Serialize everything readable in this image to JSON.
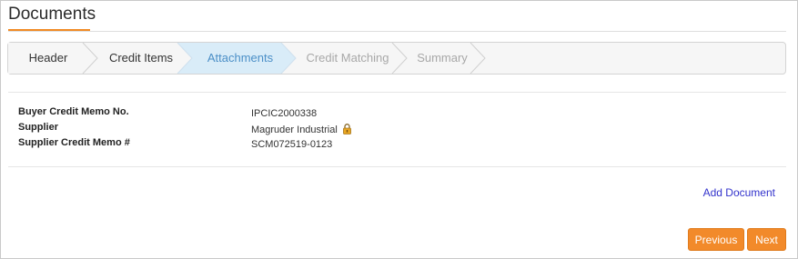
{
  "page": {
    "title": "Documents"
  },
  "wizard": {
    "steps": [
      {
        "label": "Header",
        "state": "done"
      },
      {
        "label": "Credit Items",
        "state": "done"
      },
      {
        "label": "Attachments",
        "state": "active"
      },
      {
        "label": "Credit Matching",
        "state": "todo"
      },
      {
        "label": "Summary",
        "state": "todo"
      }
    ]
  },
  "details": {
    "buyer_memo_label": "Buyer Credit Memo No.",
    "buyer_memo_value": "IPCIC2000338",
    "supplier_label": "Supplier",
    "supplier_value": "Magruder Industrial",
    "supplier_icon": "lock-icon",
    "supplier_memo_label": "Supplier Credit Memo #",
    "supplier_memo_value": "SCM072519-0123"
  },
  "actions": {
    "add_document": "Add Document",
    "previous": "Previous",
    "next": "Next"
  },
  "colors": {
    "accent": "#f28a2a",
    "active_step_bg": "#d9ecf8",
    "active_step_text": "#4b8fc7",
    "link": "#3333cc"
  }
}
